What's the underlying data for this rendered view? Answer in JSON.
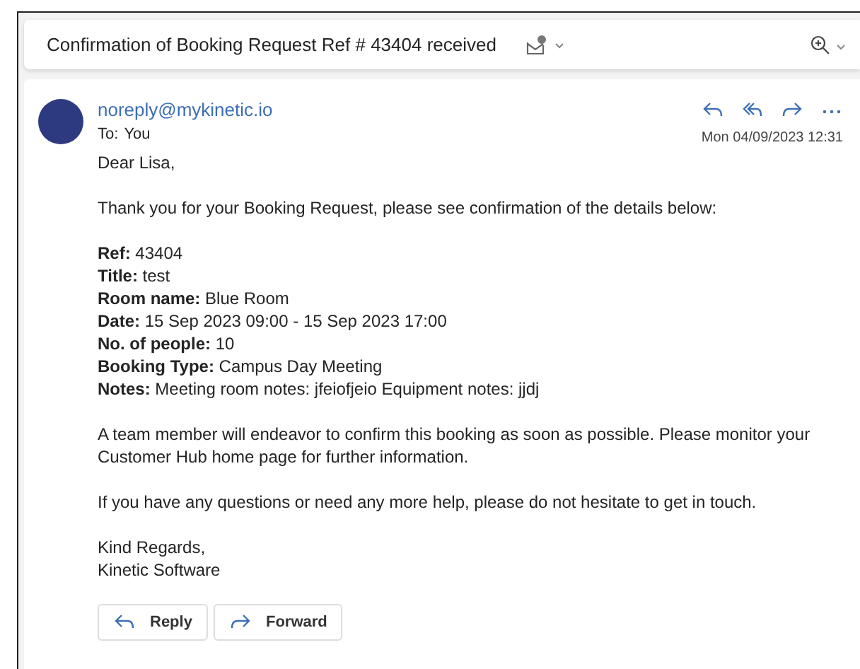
{
  "subject": {
    "title": "Confirmation of Booking Request Ref # 43404 received"
  },
  "message": {
    "sender": "noreply@mykinetic.io",
    "to_label": "To:",
    "to": "You",
    "date": "Mon 04/09/2023 12:31",
    "greeting": "Dear Lisa,",
    "intro": "Thank you for your Booking Request, please see confirmation of the details below:",
    "details": [
      "**Ref:** 43404",
      "**Title:** test",
      "**Room name:** Blue Room",
      "**Date:** 15 Sep 2023 09:00 - 15 Sep 2023 17:00",
      "**No. of people:** 10",
      "**Booking Type:** Campus Day Meeting",
      "**Notes:** Meeting room notes: jfeiofjeio Equipment notes: jjdj"
    ],
    "paragraphs": [
      "A team member will endeavor to confirm this booking as soon as possible. Please monitor your Customer Hub home page for further information.",
      "If you have any questions or need any more help, please do not hesitate to get in touch."
    ],
    "signature": [
      "Kind Regards,",
      "Kinetic Software"
    ],
    "buttons": [
      {
        "label": "Reply",
        "kind": "reply"
      },
      {
        "label": "Forward",
        "kind": "forward"
      }
    ]
  }
}
